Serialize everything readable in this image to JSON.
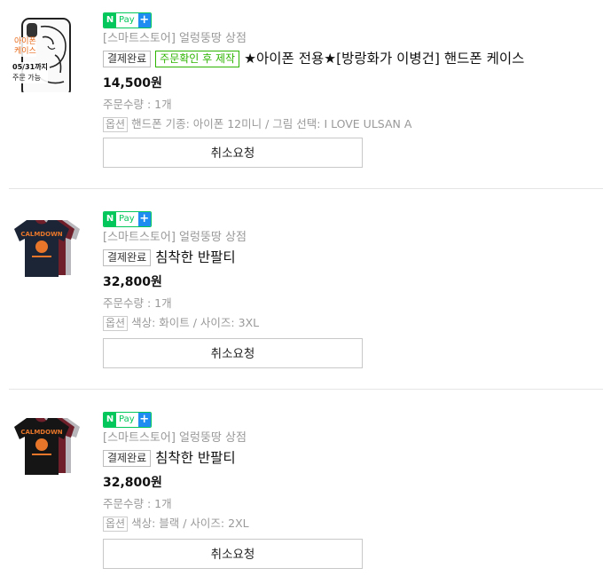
{
  "npay": {
    "n": "N",
    "pay": "Pay",
    "plus": "+"
  },
  "orders": [
    {
      "thumb_case": {
        "name_line1": "아이폰",
        "name_line2": "케이스",
        "date_line": "05/31까지",
        "order_line": "주문 가능"
      },
      "store": "[스마트스토어] 얼렁뚱땅 상점",
      "status_badge": "결제완료",
      "extra_badge": "주문확인 후 제작",
      "product_name": "★아이폰 전용★[방랑화가 이병건] 핸드폰 케이스",
      "price": "14,500원",
      "quantity": "주문수량 : 1개",
      "option_label": "옵션",
      "option_text": "핸드폰 기종: 아이폰 12미니 / 그림 선택: I LOVE ULSAN A",
      "cancel_label": "취소요청"
    },
    {
      "store": "[스마트스토어] 얼렁뚱땅 상점",
      "status_badge": "결제완료",
      "product_name": "침착한 반팔티",
      "price": "32,800원",
      "quantity": "주문수량 : 1개",
      "option_label": "옵션",
      "option_text": "색상: 화이트 / 사이즈: 3XL",
      "cancel_label": "취소요청"
    },
    {
      "store": "[스마트스토어] 얼렁뚱땅 상점",
      "status_badge": "결제완료",
      "product_name": "침착한 반팔티",
      "price": "32,800원",
      "quantity": "주문수량 : 1개",
      "option_label": "옵션",
      "option_text": "색상: 블랙 / 사이즈: 2XL",
      "cancel_label": "취소요청"
    }
  ],
  "colors": {
    "npay_green": "#03c75a",
    "npay_blue": "#1e8cf0",
    "badge_green": "#2db400",
    "tshirt_navy": "#1b2536",
    "tshirt_maroon": "#6e1f2a",
    "tshirt_gray": "#b8b8bc",
    "print_orange": "#e8762a"
  }
}
